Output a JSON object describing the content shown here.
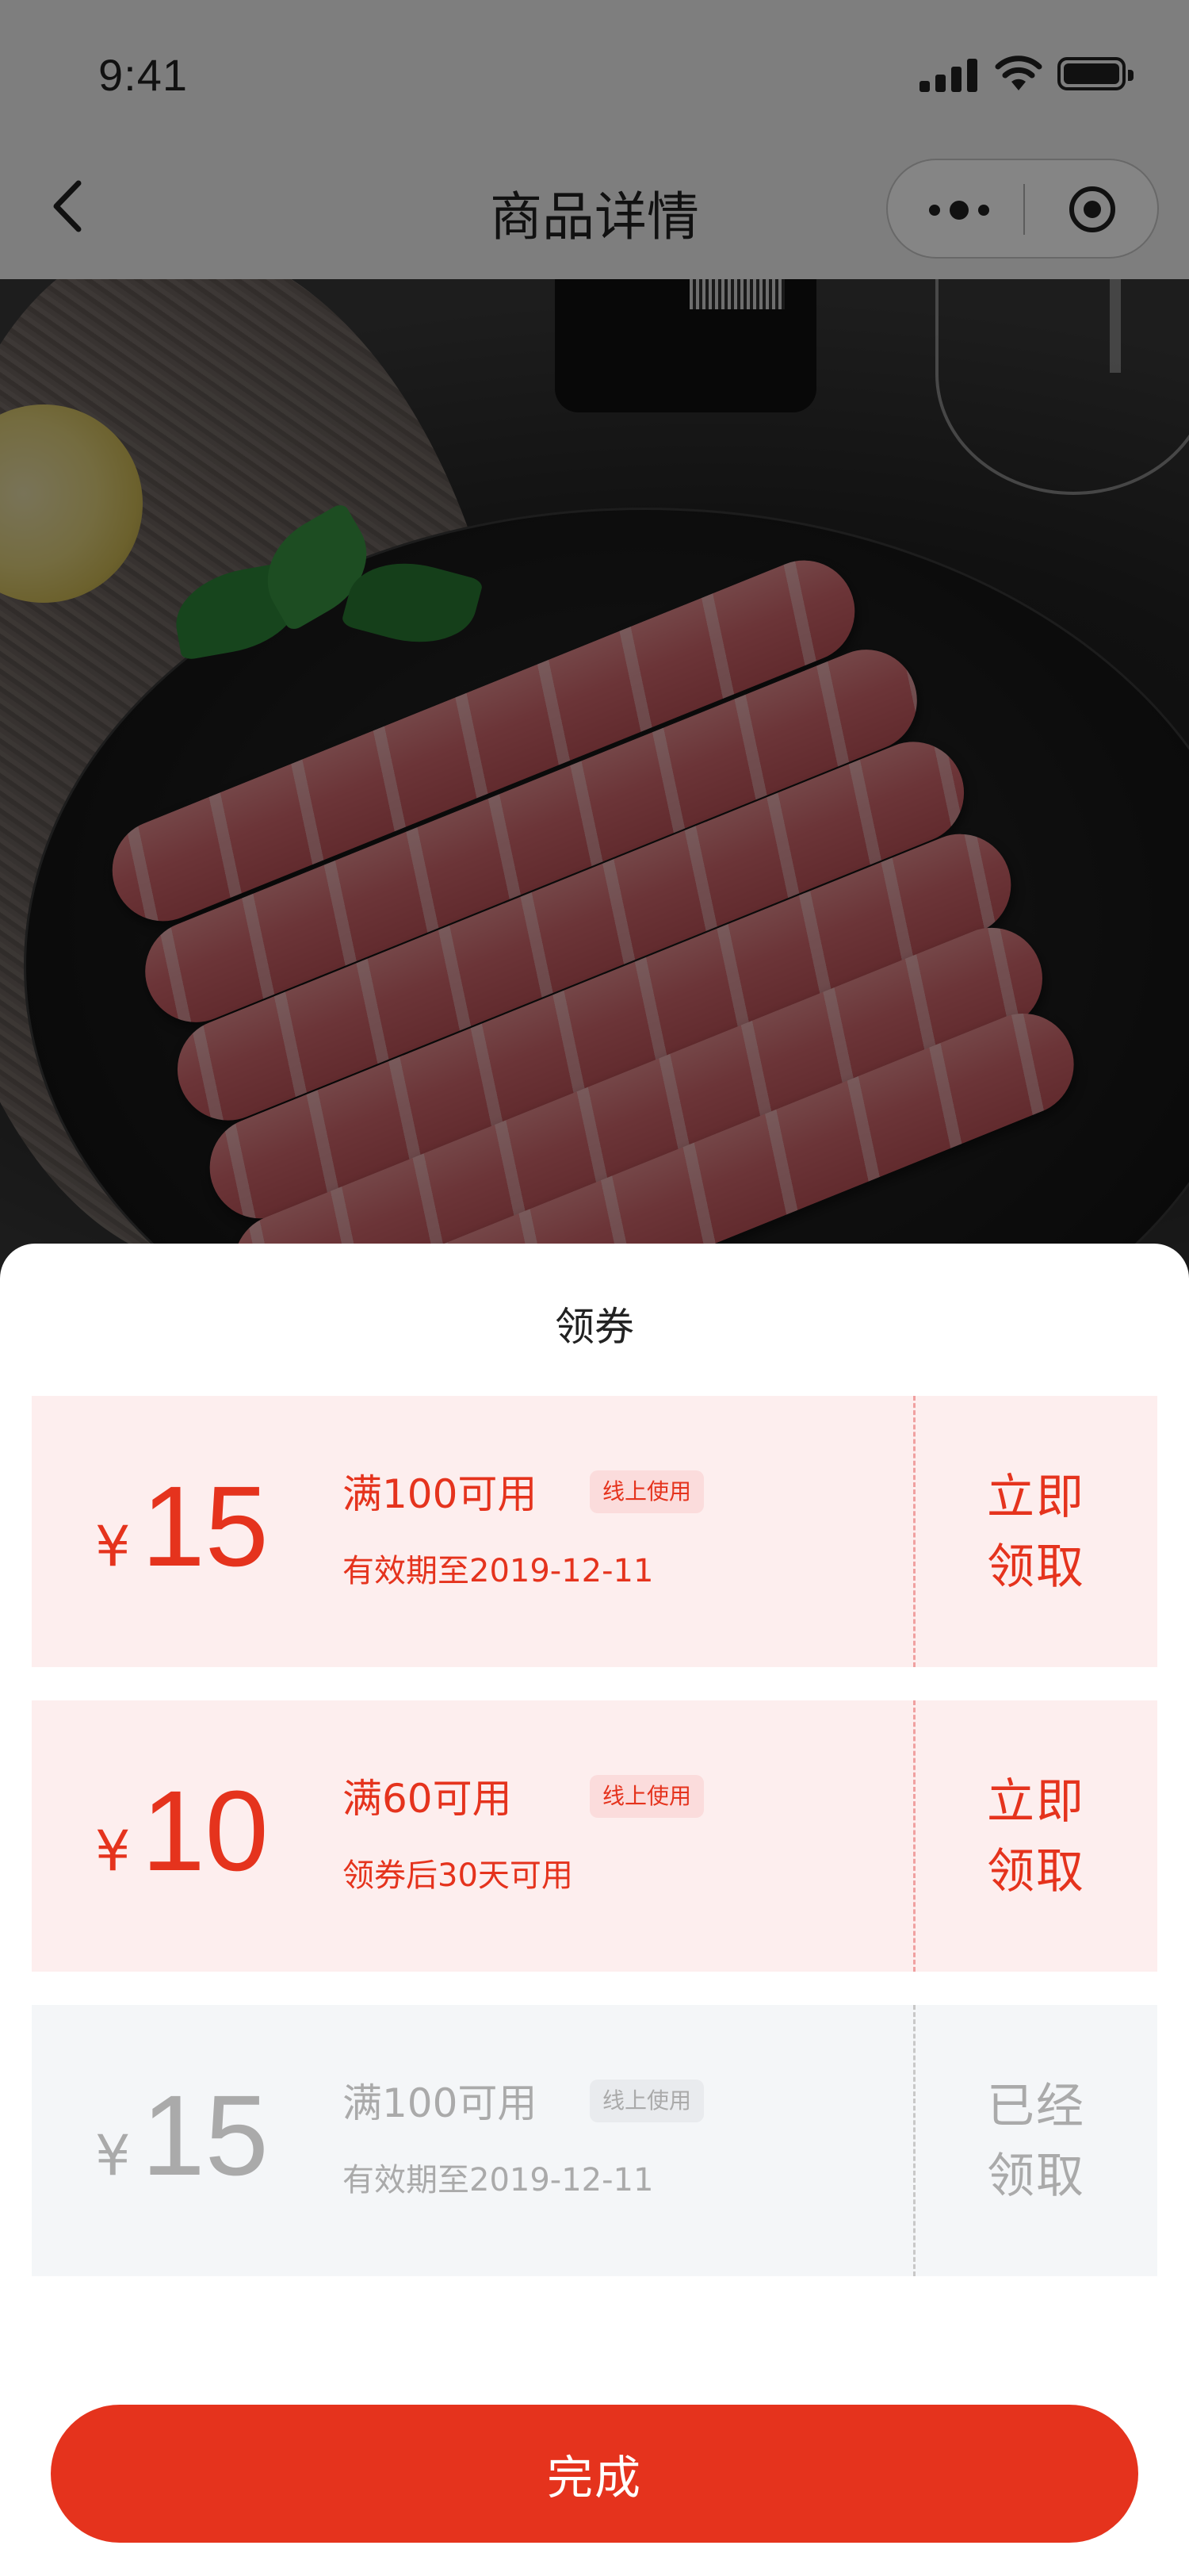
{
  "status_bar": {
    "time": "9:41"
  },
  "nav": {
    "title": "商品详情"
  },
  "sheet": {
    "title": "领券"
  },
  "coupons": [
    {
      "currency": "¥",
      "amount": "15",
      "condition": "满100可用",
      "tag": "线上使用",
      "validity": "有效期至2019-12-11",
      "action_line1": "立即",
      "action_line2": "领取",
      "state": "available"
    },
    {
      "currency": "¥",
      "amount": "10",
      "condition": "满60可用",
      "tag": "线上使用",
      "validity": "领券后30天可用",
      "action_line1": "立即",
      "action_line2": "领取",
      "state": "available"
    },
    {
      "currency": "¥",
      "amount": "15",
      "condition": "满100可用",
      "tag": "线上使用",
      "validity": "有效期至2019-12-11",
      "action_line1": "已经",
      "action_line2": "领取",
      "state": "claimed"
    }
  ],
  "done_button": {
    "label": "完成"
  },
  "colors": {
    "accent": "#e5331d",
    "coupon_bg": "#fdeeee",
    "claimed_bg": "#f4f6f8",
    "muted": "#aaaaaa"
  },
  "icons": [
    "back-arrow-icon",
    "more-dots-icon",
    "close-target-icon",
    "signal-icon",
    "wifi-icon",
    "battery-icon"
  ]
}
